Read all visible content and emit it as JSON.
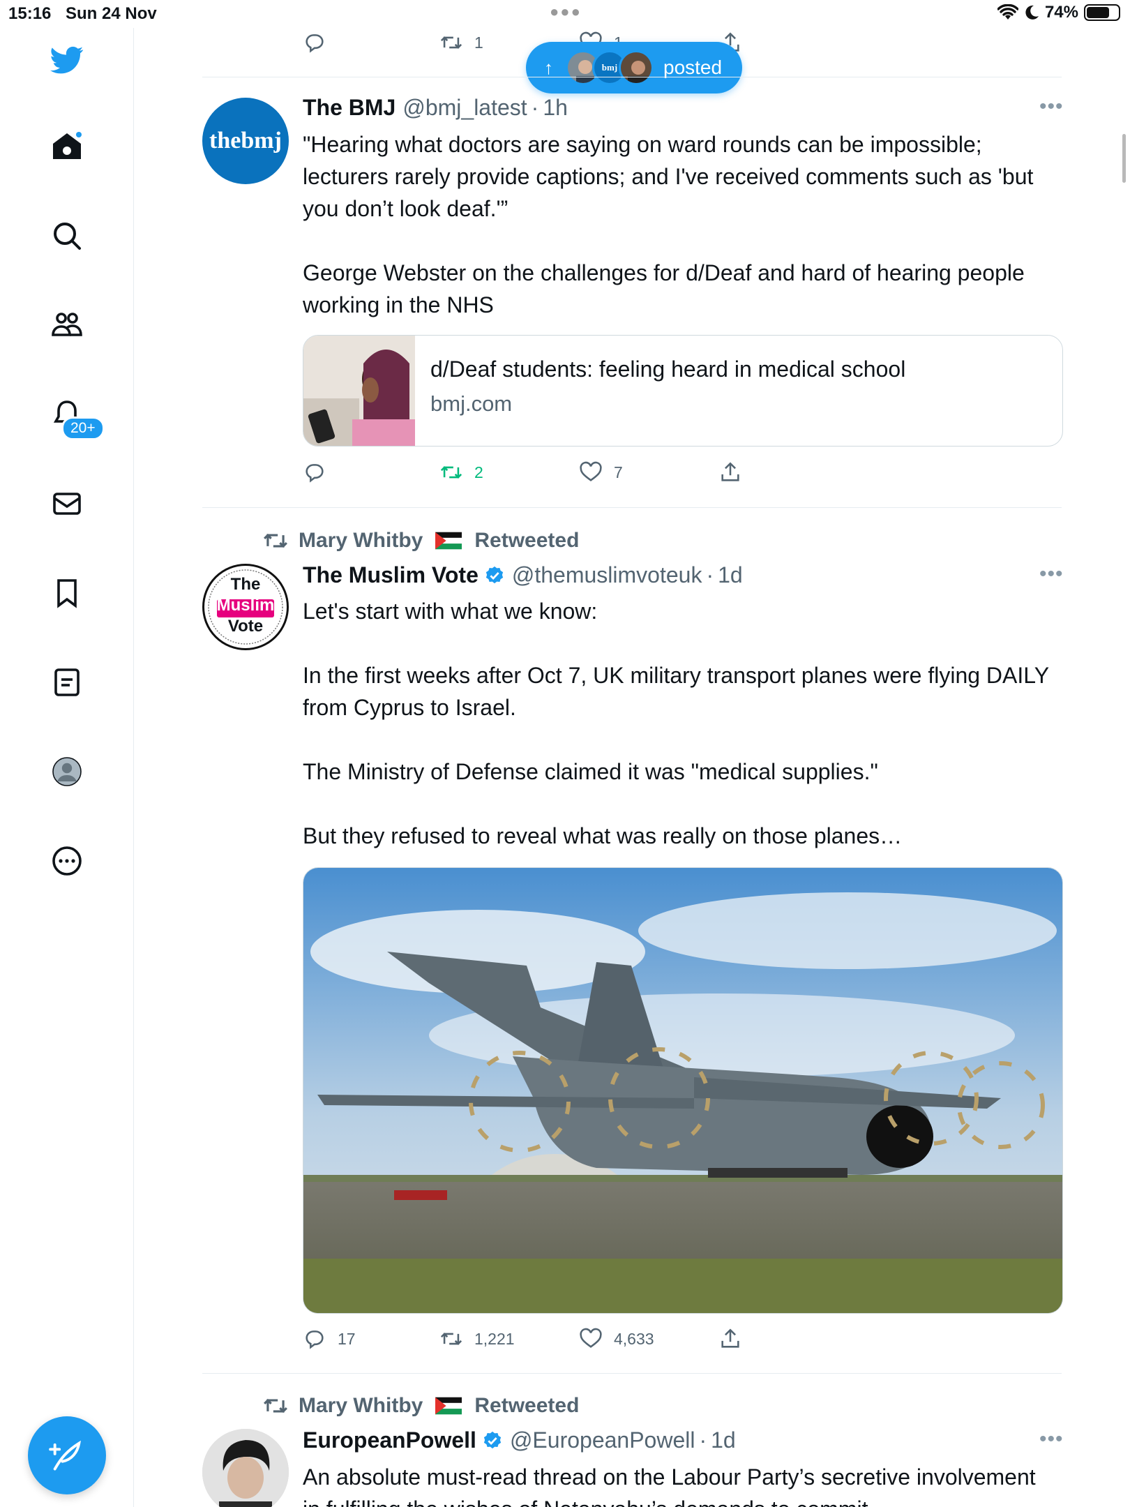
{
  "status_bar": {
    "time": "15:16",
    "date": "Sun 24 Nov",
    "battery": "74%",
    "battery_level": 0.74
  },
  "sidebar": {
    "items": [
      {
        "name": "home",
        "icon": "home-icon"
      },
      {
        "name": "explore",
        "icon": "search-icon"
      },
      {
        "name": "communities",
        "icon": "people-icon"
      },
      {
        "name": "notifications",
        "icon": "bell-icon",
        "badge": "20+"
      },
      {
        "name": "messages",
        "icon": "mail-icon"
      },
      {
        "name": "bookmarks",
        "icon": "bookmark-icon"
      },
      {
        "name": "lists",
        "icon": "list-icon"
      },
      {
        "name": "profile",
        "icon": "profile-avatar-icon"
      },
      {
        "name": "more",
        "icon": "more-circle-icon"
      }
    ],
    "compose_icon": "compose-feather-icon"
  },
  "posted_pill": {
    "label": "posted",
    "avatar_text": "bmj"
  },
  "top_tweet": {
    "retweets": "1",
    "likes": "1"
  },
  "tweets": [
    {
      "name": "The BMJ",
      "handle": "@bmj_latest",
      "sep": "·",
      "time": "1h",
      "avatar_text": "thebmj",
      "text": "\"Hearing what doctors are saying on ward rounds can be impossible; lecturers rarely provide captions; and I've received comments such as 'but you don’t look deaf.'”\n\nGeorge Webster on the challenges for d/Deaf and hard of hearing people working in the NHS",
      "card": {
        "title": "d/Deaf students: feeling heard in medical school",
        "domain": "bmj.com"
      },
      "replies": "",
      "retweets": "2",
      "likes": "7"
    },
    {
      "retweeted_by": "Mary Whitby",
      "retweeted_label": "Retweeted",
      "name": "The Muslim Vote",
      "handle": "@themuslimvoteuk",
      "sep": "·",
      "time": "1d",
      "avatar_lines": [
        "The",
        "Muslim",
        "Vote"
      ],
      "text": "Let's start with what we know:\n\nIn the first weeks after Oct 7, UK military transport planes were flying DAILY from Cyprus to Israel.\n\nThe Ministry of Defense claimed it was \"medical supplies.\"\n\nBut they refused to reveal what was really on those planes…",
      "image_alt": "Royal Air Force A400M transport aircraft on runway",
      "replies": "17",
      "retweets": "1,221",
      "likes": "4,633"
    },
    {
      "retweeted_by": "Mary Whitby",
      "retweeted_label": "Retweeted",
      "name": "EuropeanPowell",
      "handle": "@EuropeanPowell",
      "sep": "·",
      "time": "1d",
      "text": "An absolute must-read thread on the Labour Party’s secretive involvement in fulfilling the wishes of Netanyahu’s demands to commit"
    }
  ],
  "colors": {
    "accent": "#1d9bf0",
    "retweet_green": "#00ba7c",
    "muted": "#536471",
    "text": "#0f1419",
    "muslim_vote_pink": "#e6007e"
  }
}
